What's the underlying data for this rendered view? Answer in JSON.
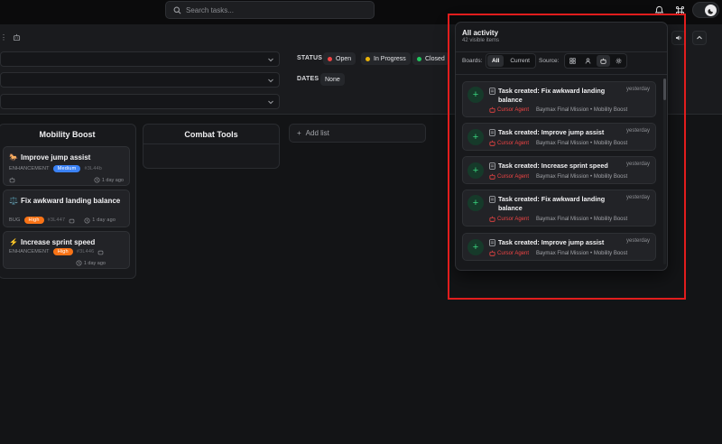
{
  "topbar": {
    "search_placeholder": "Search tasks...",
    "icons": [
      "bell-icon",
      "command-icon",
      "moon-icon"
    ]
  },
  "filters": {
    "status_label": "STATUS",
    "status_chips": [
      {
        "label": "Open",
        "color": "#ef4444"
      },
      {
        "label": "In Progress",
        "color": "#eab308"
      },
      {
        "label": "Closed",
        "color": "#22c55e"
      }
    ],
    "dates_label": "DATES",
    "dates_value": "None"
  },
  "board": {
    "columns": [
      {
        "title": "Mobility Boost",
        "cards": [
          {
            "emoji": "🐎",
            "title": "Improve jump assist",
            "type": "ENHANCEMENT",
            "priority": "Medium",
            "priority_color": "#3b82f6",
            "id": "#3L44b",
            "time": "1 day ago"
          },
          {
            "emoji": "⚖️",
            "title": "Fix awkward landing balance",
            "type": "BUG",
            "priority": "High",
            "priority_color": "#f97316",
            "id": "#3L447",
            "time": "1 day ago"
          },
          {
            "emoji": "⚡",
            "title": "Increase sprint speed",
            "type": "ENHANCEMENT",
            "priority": "High",
            "priority_color": "#f97316",
            "id": "#3L446",
            "time": "1 day ago"
          }
        ]
      },
      {
        "title": "Combat Tools",
        "cards": []
      }
    ],
    "add_list_label": "Add list"
  },
  "panel": {
    "title": "All activity",
    "subtitle": "42 visible items",
    "boards_label": "Boards:",
    "boards_options": [
      "All",
      "Current"
    ],
    "source_label": "Source:",
    "items": [
      {
        "title": "Task created: Fix awkward landing balance",
        "when": "yesterday",
        "agent": "Cursor Agent",
        "where": "Baymax Final Mission • Mobility Boost"
      },
      {
        "title": "Task created: Improve jump assist",
        "when": "yesterday",
        "agent": "Cursor Agent",
        "where": "Baymax Final Mission • Mobility Boost"
      },
      {
        "title": "Task created: Increase sprint speed",
        "when": "yesterday",
        "agent": "Cursor Agent",
        "where": "Baymax Final Mission • Mobility Boost"
      },
      {
        "title": "Task created: Fix awkward landing balance",
        "when": "yesterday",
        "agent": "Cursor Agent",
        "where": "Baymax Final Mission • Mobility Boost"
      },
      {
        "title": "Task created: Improve jump assist",
        "when": "yesterday",
        "agent": "Cursor Agent",
        "where": "Baymax Final Mission • Mobility Boost"
      }
    ]
  },
  "colors": {
    "highlight": "#e11d1d",
    "agent": "#ef4444",
    "plus_green": "#39d27d"
  }
}
